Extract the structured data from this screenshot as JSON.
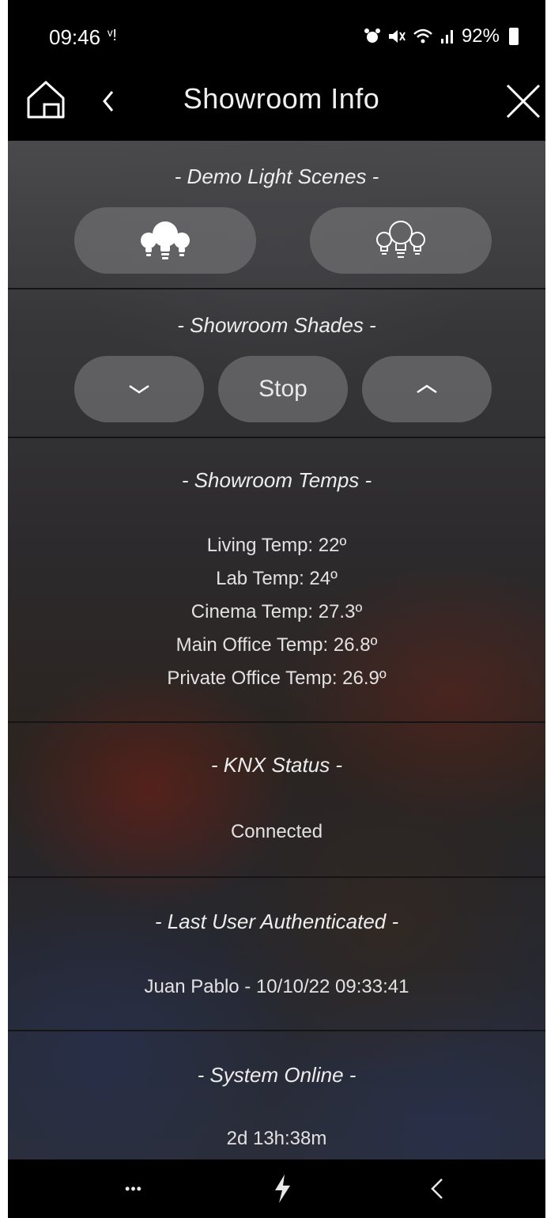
{
  "status_bar": {
    "time": "09:46",
    "battery": "92%"
  },
  "header": {
    "title": "Showroom Info"
  },
  "sections": {
    "demo_light": {
      "title": "- Demo Light Scenes -",
      "buttons": [
        "lights-on-icon",
        "lights-off-icon"
      ]
    },
    "shades": {
      "title": "- Showroom Shades -",
      "stop_label": "Stop"
    },
    "temps": {
      "title": "- Showroom Temps -",
      "lines": [
        "Living Temp: 22º",
        "Lab Temp: 24º",
        "Cinema Temp: 27.3º",
        "Main Office Temp: 26.8º",
        "Private Office Temp: 26.9º"
      ]
    },
    "knx": {
      "title": "- KNX Status -",
      "value": "Connected"
    },
    "last_user": {
      "title": "- Last User Authenticated -",
      "value": "Juan Pablo - 10/10/22 09:33:41"
    },
    "system_online": {
      "title": "- System Online -",
      "value": "2d 13h:38m"
    }
  },
  "nav_bar": {
    "more_label": "•••",
    "icons": [
      "more-icon",
      "lightning-icon",
      "back-icon"
    ]
  },
  "colors": {
    "button_fill": "#6e6e70",
    "bar_background": "#000000",
    "text": "#e8e8e8"
  }
}
